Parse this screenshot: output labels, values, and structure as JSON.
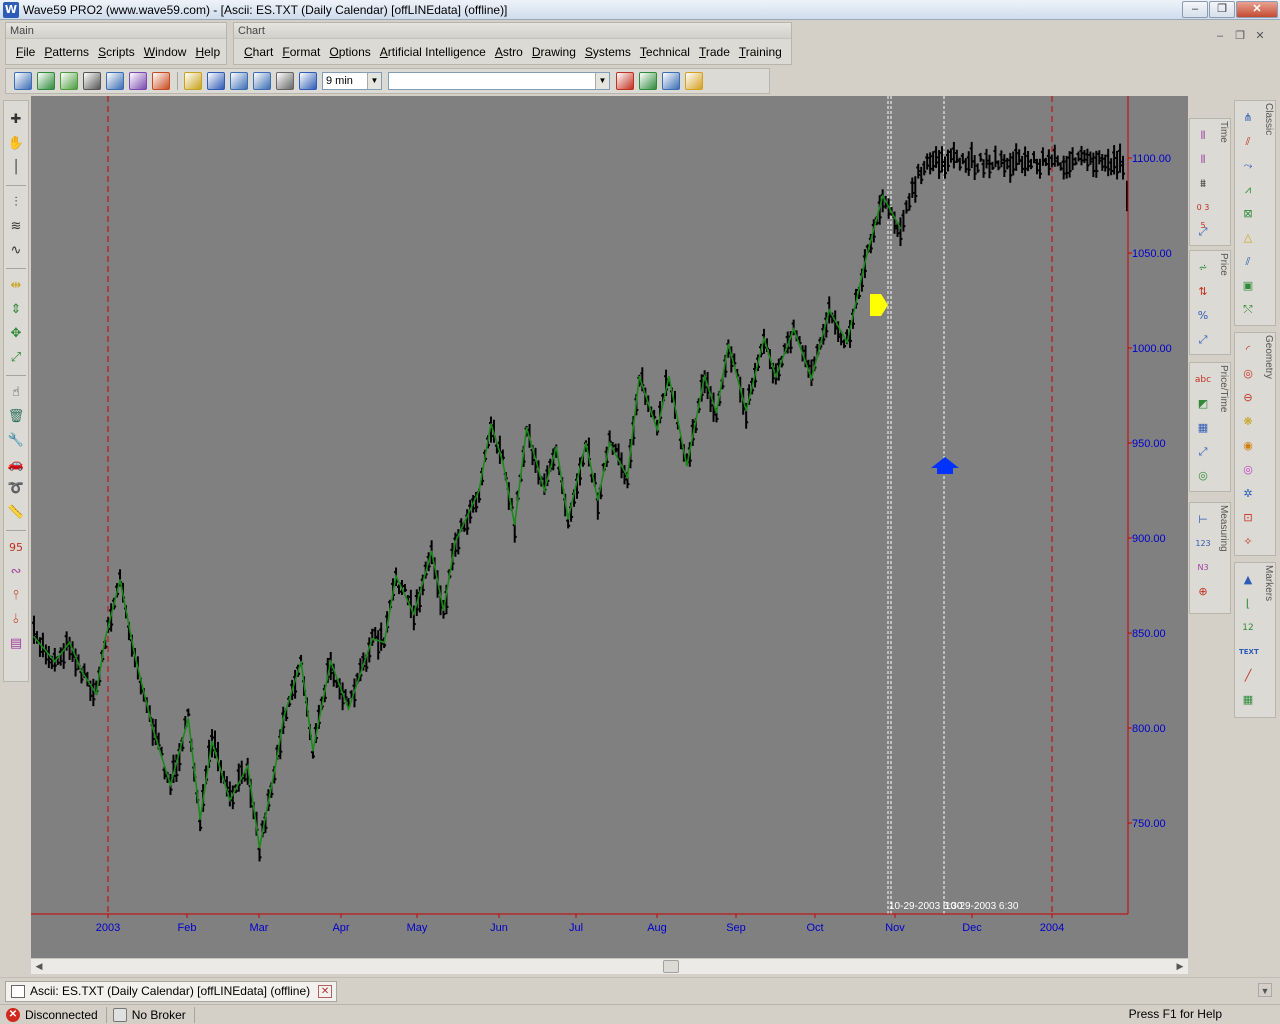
{
  "window": {
    "title": "Wave59 PRO2 (www.wave59.com) - [Ascii: ES.TXT (Daily Calendar) [offLINEdata] (offline)]",
    "app_icon": "W",
    "minimize": "–",
    "restore": "❐",
    "close": "✕"
  },
  "main_menu": {
    "title": "Main",
    "items": [
      "File",
      "Patterns",
      "Scripts",
      "Window",
      "Help"
    ]
  },
  "chart_menu": {
    "title": "Chart",
    "items": [
      "Chart",
      "Format",
      "Options",
      "Artificial Intelligence",
      "Astro",
      "Drawing",
      "Systems",
      "Technical",
      "Trade",
      "Training"
    ]
  },
  "mdi": {
    "minimize": "–",
    "restore": "❐",
    "close": "✕"
  },
  "toolbar": {
    "interval": "9 min",
    "symbol": "",
    "icon_colors": [
      "#3b6db3",
      "#2f8a3a",
      "#4b9b3d",
      "#555555",
      "#3b6db3",
      "#7a4ab0",
      "#c84a20",
      "#c8a21a",
      "#2e5bb5",
      "#3b6db3",
      "#3b6db3",
      "#666666",
      "#2e5bb5",
      "#c03020",
      "#2f8a3a",
      "#3b6db3",
      "#d4a020"
    ]
  },
  "right_palettes": {
    "classic": "Classic",
    "time": "Time",
    "price": "Price",
    "price_time": "Price/Time",
    "geometry": "Geometry",
    "measuring": "Measuring",
    "markers": "Markers"
  },
  "tab": {
    "label": "Ascii: ES.TXT (Daily Calendar) [offLINEdata] (offline)",
    "close": "✕"
  },
  "status": {
    "connection": "Disconnected",
    "broker": "No Broker",
    "help": "Press F1 for Help"
  },
  "chart_data": {
    "type": "bar",
    "title": "",
    "price_ticks": [
      "1100.00",
      "1050.00",
      "1000.00",
      "950.00",
      "900.00",
      "850.00",
      "800.00",
      "750.00"
    ],
    "month_labels": [
      "2003",
      "Feb",
      "Mar",
      "Apr",
      "May",
      "Jun",
      "Jul",
      "Aug",
      "Sep",
      "Oct",
      "Nov",
      "Dec",
      "2004"
    ],
    "ylim": [
      715,
      1115
    ],
    "series": [
      {
        "name": "",
        "x": [
          0,
          3.5,
          6,
          8,
          10.5,
          12,
          14.5,
          17,
          20,
          23,
          26,
          28,
          30,
          33,
          36,
          38,
          41,
          42,
          45,
          47,
          50,
          53,
          57,
          59,
          61,
          64,
          67,
          69,
          71,
          75,
          77,
          79,
          81,
          83,
          86,
          88,
          90,
          93,
          95,
          97,
          100,
          102,
          105,
          107,
          110,
          113,
          115,
          117,
          120,
          123,
          125,
          128,
          131,
          134,
          137,
          140,
          143,
          146,
          149,
          152,
          154,
          156,
          158,
          160,
          162,
          164,
          166,
          168,
          171,
          174,
          177,
          180,
          182,
          184
        ],
        "values": [
          848,
          835,
          845,
          830,
          818,
          847,
          878,
          838,
          800,
          770,
          805,
          752,
          793,
          762,
          780,
          737,
          785,
          805,
          835,
          788,
          835,
          810,
          847,
          845,
          880,
          860,
          893,
          862,
          898,
          925,
          960,
          940,
          907,
          958,
          925,
          948,
          910,
          950,
          920,
          950,
          932,
          985,
          957,
          985,
          938,
          985,
          966,
          1002,
          967,
          1005,
          985,
          1010,
          984,
          1020,
          1003,
          1045,
          1080,
          1063,
          1090,
          1100,
          1098,
          1098,
          1098,
          1098,
          1098,
          1098,
          1098,
          1098,
          1098,
          1098,
          1098,
          1098,
          1098,
          1098
        ]
      }
    ],
    "markers": {
      "projection_label": "10-29-2003 6:30",
      "overlap_label": "10-29-2003 6:30",
      "time_lines": [
        "2003",
        "2004"
      ]
    },
    "colors": {
      "background": "#808080",
      "bars": "#000000",
      "swing": "#1a8a1a",
      "price_text": "#0000cc",
      "axis": "#cc0000",
      "yellow_arrow": "#ffff00",
      "blue_arrow": "#0033ff"
    }
  }
}
